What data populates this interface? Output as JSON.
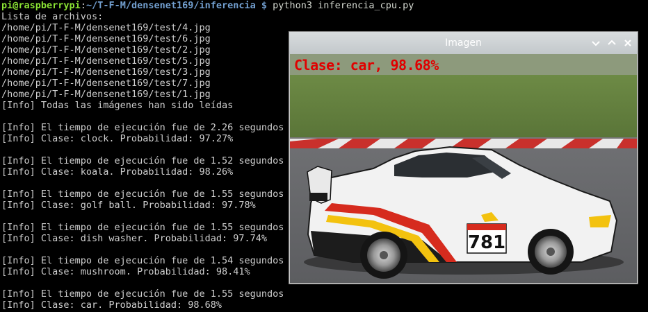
{
  "terminal": {
    "prompt_user": "pi@raspberrypi",
    "prompt_sep": ":",
    "prompt_path": "~/T-F-M/densenet169/inferencia $",
    "command": " python3 inferencia_cpu.py",
    "lines": [
      "Lista de archivos:",
      "/home/pi/T-F-M/densenet169/test/4.jpg",
      "/home/pi/T-F-M/densenet169/test/6.jpg",
      "/home/pi/T-F-M/densenet169/test/2.jpg",
      "/home/pi/T-F-M/densenet169/test/5.jpg",
      "/home/pi/T-F-M/densenet169/test/3.jpg",
      "/home/pi/T-F-M/densenet169/test/7.jpg",
      "/home/pi/T-F-M/densenet169/test/1.jpg",
      "[Info] Todas las imágenes han sido leídas",
      "",
      "[Info] El tiempo de ejecución fue de 2.26 segundos",
      "[Info] Clase: clock. Probabilidad: 97.27%",
      "",
      "[Info] El tiempo de ejecución fue de 1.52 segundos",
      "[Info] Clase: koala. Probabilidad: 98.26%",
      "",
      "[Info] El tiempo de ejecución fue de 1.55 segundos",
      "[Info] Clase: golf ball. Probabilidad: 97.78%",
      "",
      "[Info] El tiempo de ejecución fue de 1.55 segundos",
      "[Info] Clase: dish washer. Probabilidad: 97.74%",
      "",
      "[Info] El tiempo de ejecución fue de 1.54 segundos",
      "[Info] Clase: mushroom. Probabilidad: 98.41%",
      "",
      "[Info] El tiempo de ejecución fue de 1.55 segundos",
      "[Info] Clase: car. Probabilidad: 98.68%"
    ]
  },
  "window": {
    "title": "Imagen",
    "overlay_label": "Clase: car, 98.68%",
    "car_number": "781",
    "icons": [
      "chevron-down-icon",
      "chevron-up-icon",
      "close-icon"
    ]
  },
  "colors": {
    "background": "#000000",
    "text": "#cfcfcf",
    "prompt_user": "#8ae234",
    "prompt_path": "#729fcf",
    "overlay": "#e00000"
  }
}
